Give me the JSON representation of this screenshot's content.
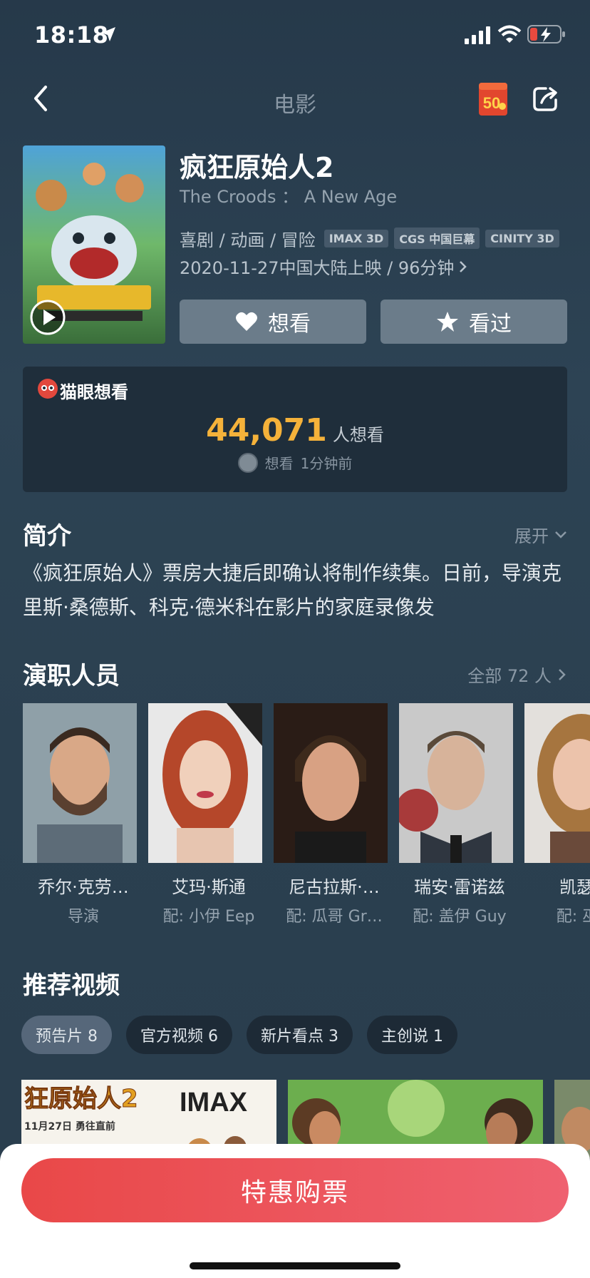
{
  "status_bar": {
    "time": "18:18"
  },
  "nav": {
    "title": "电影",
    "badge_text": "50"
  },
  "movie": {
    "title": "疯狂原始人2",
    "english_title": "The Croods ： A New Age",
    "genres": "喜剧 / 动画 / 冒险",
    "formats": [
      "IMAX 3D",
      "CGS 中国巨幕",
      "CINITY 3D"
    ],
    "release": "2020-11-27中国大陆上映 / 96分钟"
  },
  "actions": {
    "want": "想看",
    "seen": "看过"
  },
  "maoyan": {
    "label": "猫眼想看",
    "count": "44,071",
    "count_unit": "人想看",
    "recent_action": "想看",
    "recent_time": "1分钟前"
  },
  "intro": {
    "title": "简介",
    "more": "展开",
    "text": "《疯狂原始人》票房大捷后即确认将制作续集。日前，导演克里斯·桑德斯、科克·德米科在影片的家庭录像发"
  },
  "cast": {
    "title": "演职人员",
    "more": "全部 72 人",
    "members": [
      {
        "name": "乔尔·克劳…",
        "role": "导演"
      },
      {
        "name": "艾玛·斯通",
        "role": "配: 小伊 Eep"
      },
      {
        "name": "尼古拉斯·…",
        "role": "配: 瓜哥 Gr…"
      },
      {
        "name": "瑞安·雷诺兹",
        "role": "配: 盖伊 Guy"
      },
      {
        "name": "凯瑟琳",
        "role": "配: 巫嘎"
      }
    ]
  },
  "videos": {
    "title": "推荐视频",
    "tabs": [
      {
        "label": "预告片 8"
      },
      {
        "label": "官方视频 6"
      },
      {
        "label": "新片看点 3"
      },
      {
        "label": "主创说 1"
      }
    ],
    "thumb_1_text": "狂原始人2",
    "thumb_1_subtext": "11月27日 勇往直前",
    "thumb_1_brand": "IMAX"
  },
  "buy_button": "特惠购票",
  "colors": {
    "accent": "#f5b23a",
    "buy": "#e94848",
    "bg": "#2d4354"
  }
}
